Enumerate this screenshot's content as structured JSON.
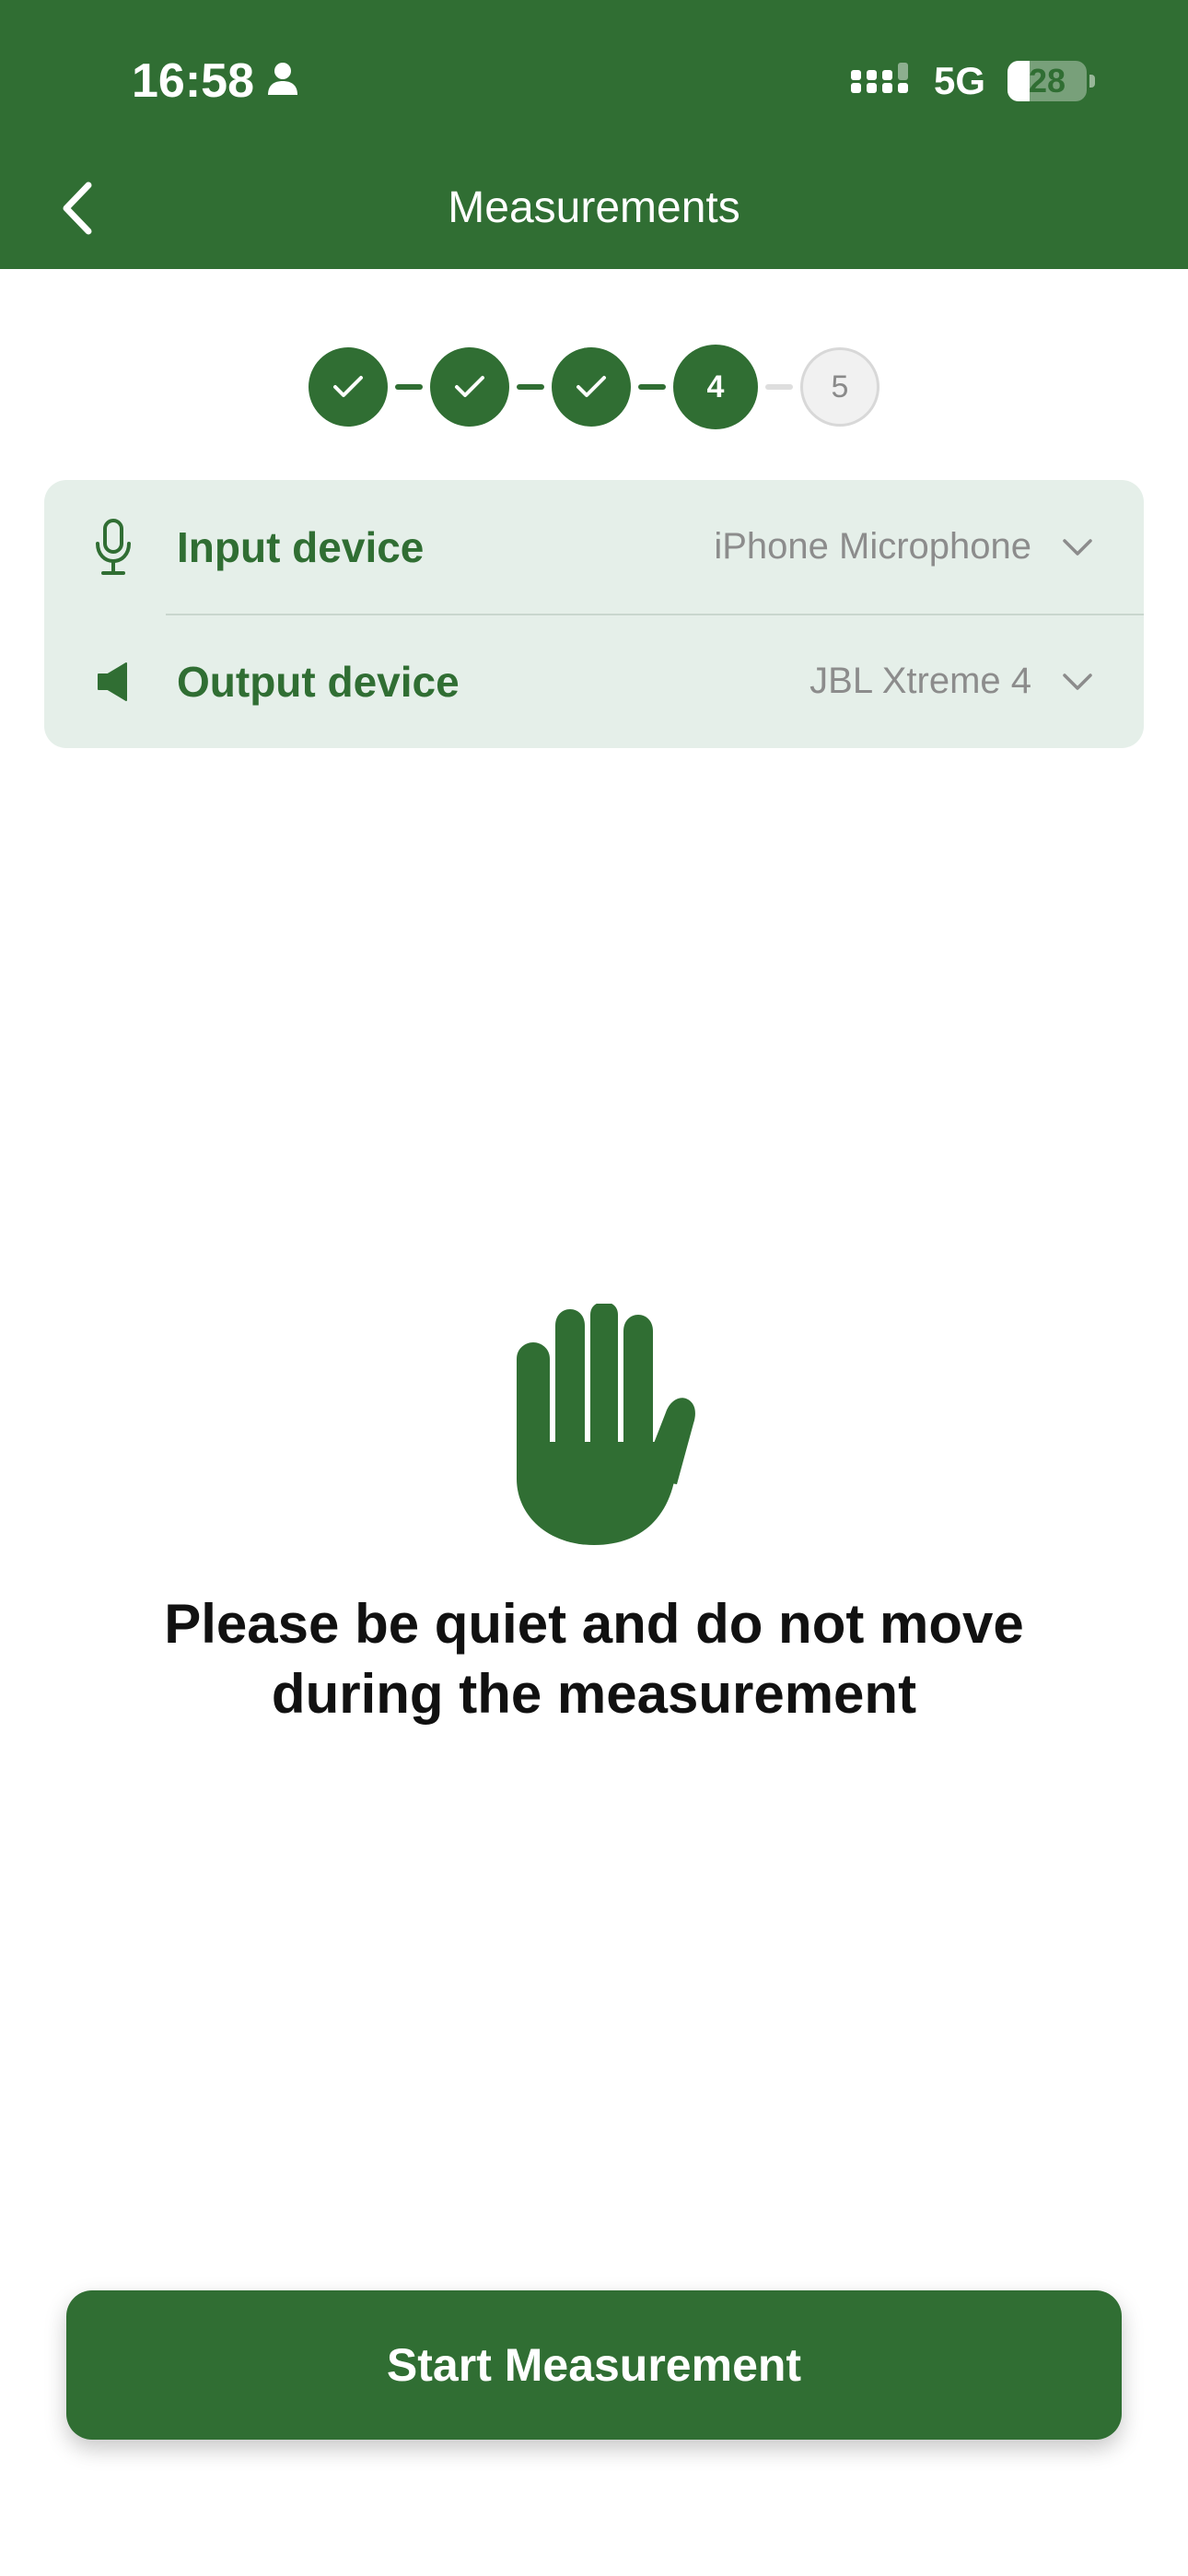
{
  "status_bar": {
    "time": "16:58",
    "network": "5G",
    "battery_percent": "28",
    "battery_level": 0.28
  },
  "header": {
    "title": "Measurements",
    "back_icon": "chevron-left-icon"
  },
  "stepper": {
    "steps": [
      {
        "state": "done",
        "label": ""
      },
      {
        "state": "done",
        "label": ""
      },
      {
        "state": "done",
        "label": ""
      },
      {
        "state": "current",
        "label": "4"
      },
      {
        "state": "future",
        "label": "5"
      }
    ]
  },
  "devices": {
    "input": {
      "label": "Input device",
      "value": "iPhone Microphone",
      "icon": "microphone-icon"
    },
    "output": {
      "label": "Output device",
      "value": "JBL Xtreme 4",
      "icon": "speaker-icon"
    }
  },
  "message": "Please be quiet and do not move during the measurement",
  "start_button": {
    "label": "Start Measurement"
  },
  "colors": {
    "brand": "#306e33",
    "card_bg": "#e5efe9",
    "muted_text": "#8c8c8c"
  }
}
